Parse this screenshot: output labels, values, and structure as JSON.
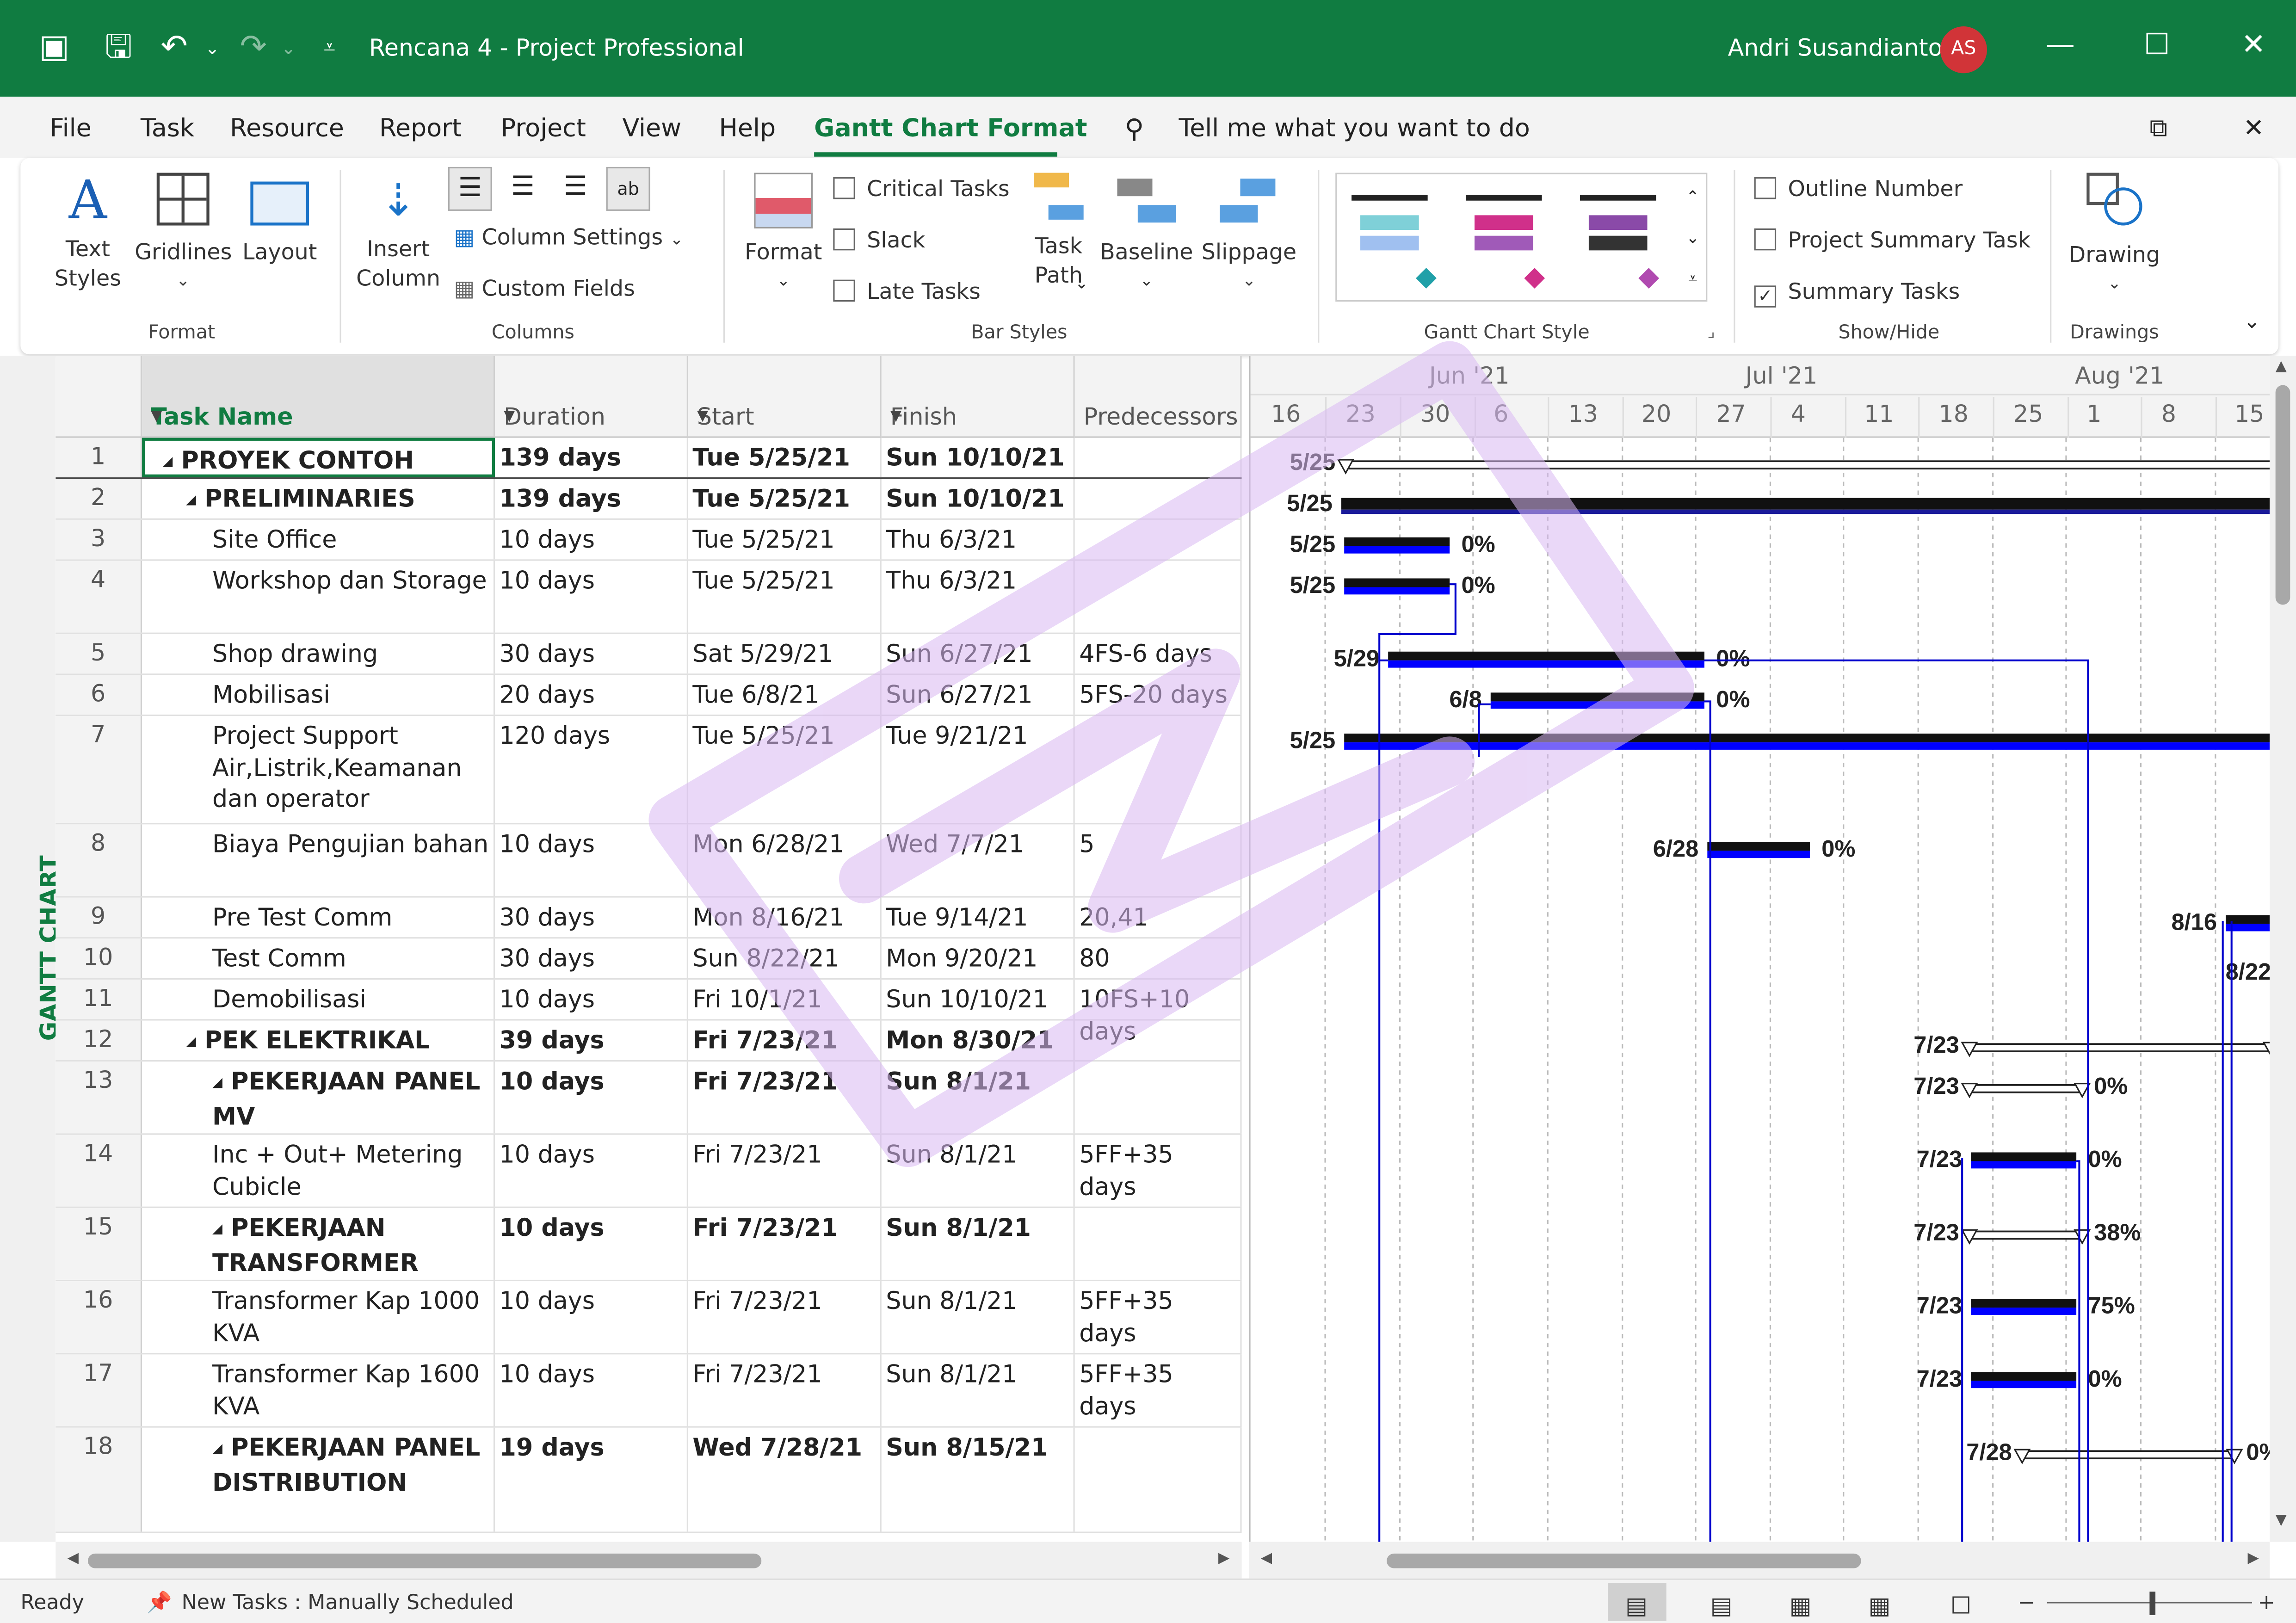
{
  "titlebar": {
    "title": "Rencana 4  -  Project Professional",
    "user": "Andri Susandianto",
    "avatar": "AS"
  },
  "menu": [
    "File",
    "Task",
    "Resource",
    "Report",
    "Project",
    "View",
    "Help",
    "Gantt Chart Format"
  ],
  "search": "Tell me what you want to do",
  "ribbon": {
    "text_styles": "Text\nStyles",
    "gridlines": "Gridlines",
    "layout": "Layout",
    "group_format": "Format",
    "insert_column": "Insert\nColumn",
    "column_settings": "Column Settings",
    "custom_fields": "Custom Fields",
    "group_columns": "Columns",
    "format": "Format",
    "critical_tasks": "Critical Tasks",
    "slack": "Slack",
    "late_tasks": "Late Tasks",
    "task_path": "Task\nPath",
    "baseline": "Baseline",
    "slippage": "Slippage",
    "group_bar_styles": "Bar Styles",
    "group_gantt_style": "Gantt Chart Style",
    "outline_number": "Outline Number",
    "project_summary_task": "Project Summary Task",
    "summary_tasks": "Summary Tasks",
    "group_show_hide": "Show/Hide",
    "drawing": "Drawing",
    "group_drawings": "Drawings"
  },
  "vertical_tab": "GANTT CHART",
  "columns": [
    "Task Name",
    "Duration",
    "Start",
    "Finish",
    "Predecessors"
  ],
  "rows": [
    {
      "id": "1",
      "name": "PROYEK CONTOH",
      "dur": "139 days",
      "start": "Tue 5/25/21",
      "finish": "Sun 10/10/21",
      "pred": ""
    },
    {
      "id": "2",
      "name": "PRELIMINARIES",
      "dur": "139 days",
      "start": "Tue 5/25/21",
      "finish": "Sun 10/10/21",
      "pred": ""
    },
    {
      "id": "3",
      "name": "Site Office",
      "dur": "10 days",
      "start": "Tue 5/25/21",
      "finish": "Thu 6/3/21",
      "pred": ""
    },
    {
      "id": "4",
      "name": "Workshop dan Storage",
      "dur": "10 days",
      "start": "Tue 5/25/21",
      "finish": "Thu 6/3/21",
      "pred": ""
    },
    {
      "id": "5",
      "name": "Shop drawing",
      "dur": "30 days",
      "start": "Sat 5/29/21",
      "finish": "Sun 6/27/21",
      "pred": "4FS-6 days"
    },
    {
      "id": "6",
      "name": "Mobilisasi",
      "dur": "20 days",
      "start": "Tue 6/8/21",
      "finish": "Sun 6/27/21",
      "pred": "5FS-20 days"
    },
    {
      "id": "7",
      "name": "Project Support Air,Listrik,Keamanan dan operator",
      "dur": "120 days",
      "start": "Tue 5/25/21",
      "finish": "Tue 9/21/21",
      "pred": ""
    },
    {
      "id": "8",
      "name": "Biaya Pengujian bahan",
      "dur": "10 days",
      "start": "Mon 6/28/21",
      "finish": "Wed 7/7/21",
      "pred": "5"
    },
    {
      "id": "9",
      "name": "Pre Test Comm",
      "dur": "30 days",
      "start": "Mon 8/16/21",
      "finish": "Tue 9/14/21",
      "pred": "20,41"
    },
    {
      "id": "10",
      "name": "Test Comm",
      "dur": "30 days",
      "start": "Sun 8/22/21",
      "finish": "Mon 9/20/21",
      "pred": "80"
    },
    {
      "id": "11",
      "name": "Demobilisasi",
      "dur": "10 days",
      "start": "Fri 10/1/21",
      "finish": "Sun 10/10/21",
      "pred": "10FS+10 days"
    },
    {
      "id": "12",
      "name": "PEK ELEKTRIKAL",
      "dur": "39 days",
      "start": "Fri 7/23/21",
      "finish": "Mon 8/30/21",
      "pred": ""
    },
    {
      "id": "13",
      "name": "PEKERJAAN PANEL MV",
      "dur": "10 days",
      "start": "Fri 7/23/21",
      "finish": "Sun 8/1/21",
      "pred": ""
    },
    {
      "id": "14",
      "name": "Inc + Out+ Metering Cubicle",
      "dur": "10 days",
      "start": "Fri 7/23/21",
      "finish": "Sun 8/1/21",
      "pred": "5FF+35 days"
    },
    {
      "id": "15",
      "name": "PEKERJAAN TRANSFORMER",
      "dur": "10 days",
      "start": "Fri 7/23/21",
      "finish": "Sun 8/1/21",
      "pred": ""
    },
    {
      "id": "16",
      "name": "Transformer Kap 1000 KVA",
      "dur": "10 days",
      "start": "Fri 7/23/21",
      "finish": "Sun 8/1/21",
      "pred": "5FF+35 days"
    },
    {
      "id": "17",
      "name": "Transformer Kap 1600 KVA",
      "dur": "10 days",
      "start": "Fri 7/23/21",
      "finish": "Sun 8/1/21",
      "pred": "5FF+35 days"
    },
    {
      "id": "18",
      "name": "PEKERJAAN PANEL DISTRIBUTION",
      "dur": "19 days",
      "start": "Wed 7/28/21",
      "finish": "Sun 8/15/21",
      "pred": ""
    }
  ],
  "timescale": {
    "months": [
      {
        "label": "Jun '21"
      },
      {
        "label": "Jul '21"
      },
      {
        "label": "Aug '21"
      }
    ],
    "days": [
      "16",
      "23",
      "30",
      "6",
      "13",
      "20",
      "27",
      "4",
      "11",
      "18",
      "25",
      "1",
      "8",
      "15"
    ]
  },
  "bars": [
    {
      "row": "1",
      "label": "5/25",
      "pct": ""
    },
    {
      "row": "2",
      "label": "5/25",
      "pct": ""
    },
    {
      "row": "3",
      "label": "5/25",
      "pct": "0%"
    },
    {
      "row": "4",
      "label": "5/25",
      "pct": "0%"
    },
    {
      "row": "5",
      "label": "5/29",
      "pct": "0%"
    },
    {
      "row": "6",
      "label": "6/8",
      "pct": "0%"
    },
    {
      "row": "7",
      "label": "5/25",
      "pct": ""
    },
    {
      "row": "8",
      "label": "6/28",
      "pct": "0%"
    },
    {
      "row": "9",
      "label": "8/16",
      "pct": ""
    },
    {
      "row": "10",
      "label": "8/22",
      "pct": ""
    },
    {
      "row": "12",
      "label": "7/23",
      "pct": ""
    },
    {
      "row": "13",
      "label": "7/23",
      "pct": "0%"
    },
    {
      "row": "14",
      "label": "7/23",
      "pct": "0%"
    },
    {
      "row": "15",
      "label": "7/23",
      "pct": "38%"
    },
    {
      "row": "16",
      "label": "7/23",
      "pct": "75%"
    },
    {
      "row": "17",
      "label": "7/23",
      "pct": "0%"
    },
    {
      "row": "18",
      "label": "7/28",
      "pct": "0%"
    }
  ],
  "status": {
    "ready": "Ready",
    "new_tasks": "New Tasks : Manually Scheduled"
  },
  "colors": {
    "accent": "#107c41",
    "bar": "#0000ff",
    "watermark": "#d9b8f2"
  }
}
